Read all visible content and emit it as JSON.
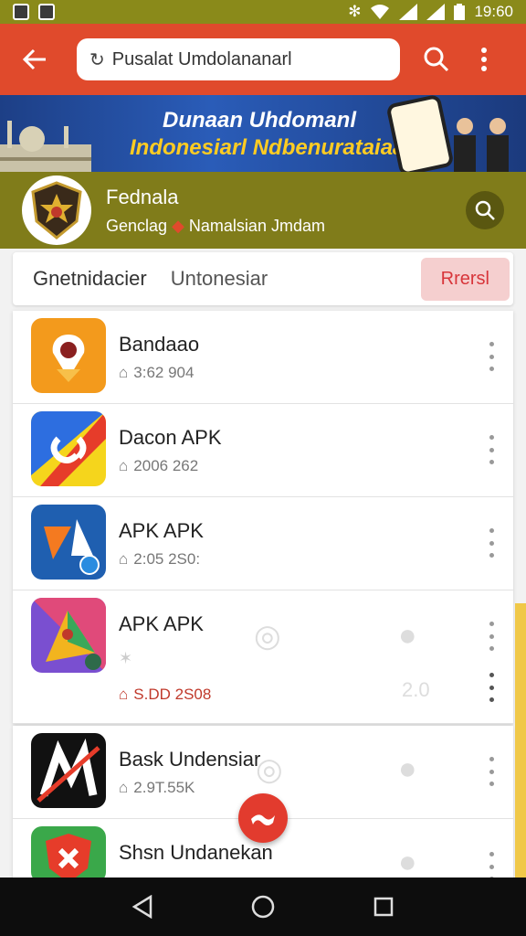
{
  "status_bar": {
    "time": "19:60"
  },
  "app_bar": {
    "search_text": "Pusalat Umdolananarl",
    "search_prefix_icon": "refresh-icon",
    "colors": {
      "accent": "#e04a2c"
    }
  },
  "banner": {
    "line1": "Dunaan Uhdomanl",
    "line2": "Indonesiarl Ndbenurataiaa"
  },
  "channel": {
    "name": "Fednala",
    "subtitle_part1": "Genclag",
    "subtitle_part2": "Namalsian Jmdam"
  },
  "tabs": {
    "tab1": "Gnetnidacier",
    "tab2": "Untonesiar",
    "pill": "Rrersl"
  },
  "apps": [
    {
      "name": "Bandaao",
      "meta": "3:62 904",
      "icon": "location-pin-app-icon"
    },
    {
      "name": "Dacon APK",
      "meta": "2006 262",
      "icon": "link-app-icon"
    },
    {
      "name": "APK APK",
      "meta": "2:05 2S0:",
      "icon": "blue-app-icon"
    },
    {
      "name": "APK APK",
      "meta": "S.DD 2S08",
      "icon": "gradient-app-icon",
      "ghost_label": "2.0"
    },
    {
      "name": "Bask Undensiar",
      "meta": "2.9T.55K",
      "icon": "m-logo-app-icon"
    },
    {
      "name": "Shsn Undanekan",
      "meta": "",
      "icon": "shield-app-icon"
    }
  ]
}
